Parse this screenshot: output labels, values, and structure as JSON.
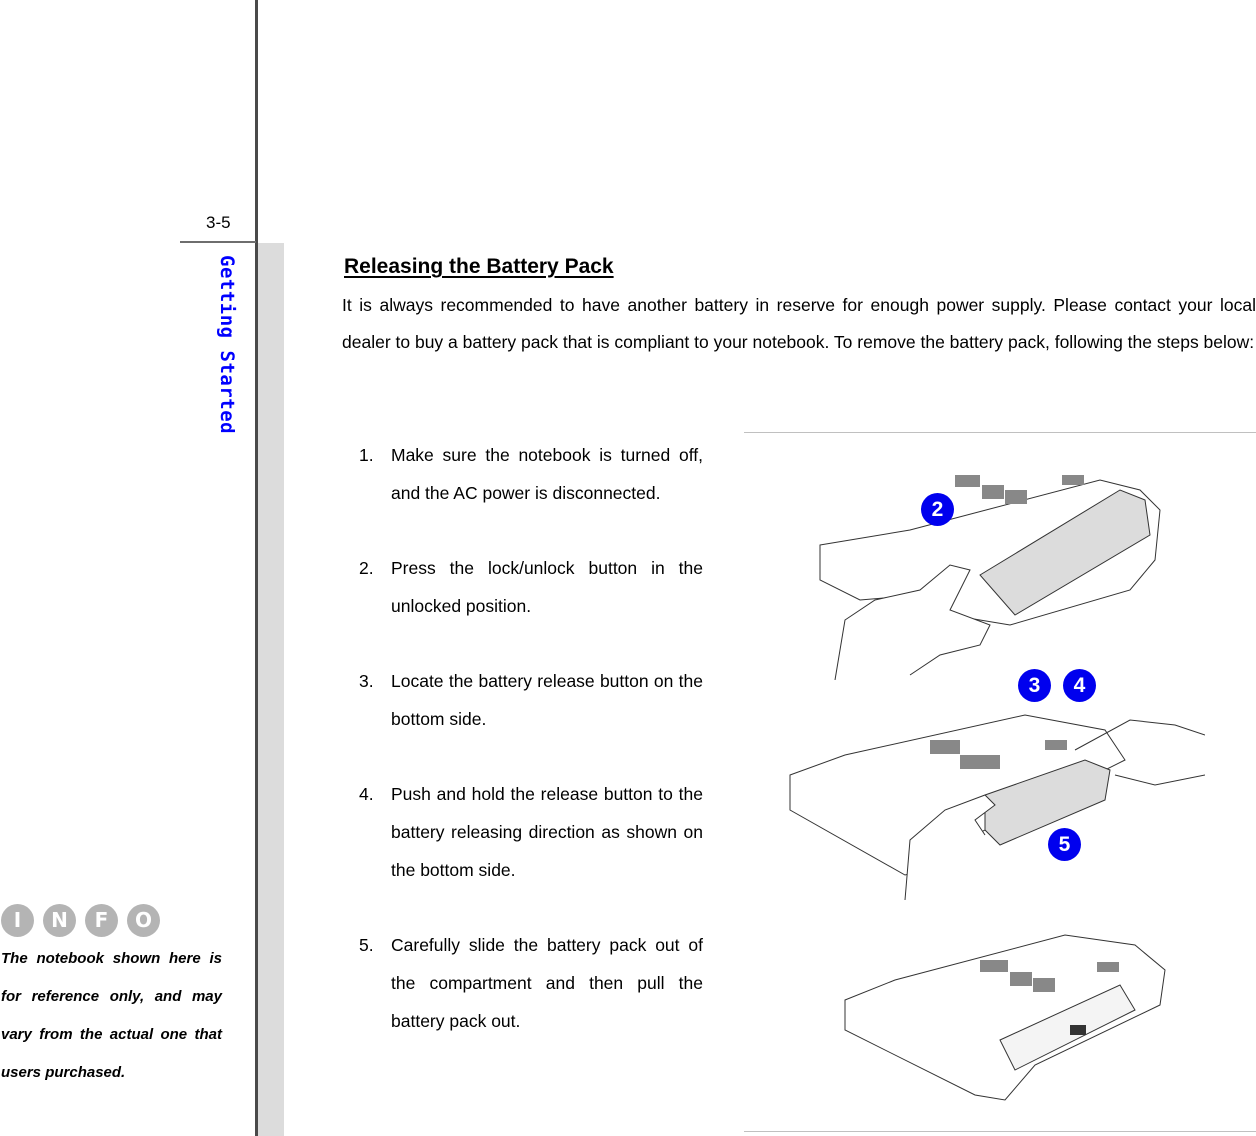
{
  "sidebar": {
    "page_number": "3-5",
    "chapter_title": "Getting Started",
    "info_icons": [
      "I",
      "N",
      "F",
      "O"
    ],
    "info_note": "The notebook shown here is for reference only, and may vary from the actual one that users purchased."
  },
  "main": {
    "title": "Releasing the Battery Pack",
    "intro": "It is always recommended to have another battery in reserve for enough power supply.   Please contact your local dealer to buy a battery pack that is compliant to your notebook.   To remove the battery pack, following the steps below:",
    "steps": [
      {
        "num": "1.",
        "text": "Make sure the notebook is turned off, and the AC power is disconnected."
      },
      {
        "num": "2.",
        "text": "Press the lock/unlock button in the unlocked position."
      },
      {
        "num": "3.",
        "text": "Locate the battery release button on the bottom side."
      },
      {
        "num": "4.",
        "text": "Push and hold the release button to the battery releasing direction as shown on the bottom side."
      },
      {
        "num": "5.",
        "text": "Carefully slide the battery pack out of the compartment and then pull the battery pack out."
      }
    ]
  },
  "figures": {
    "badges": [
      "2",
      "3",
      "4",
      "5"
    ],
    "colors": {
      "badge": "#0000ee",
      "chapter": "#0000ff",
      "battery": "#dcdcdc"
    }
  }
}
